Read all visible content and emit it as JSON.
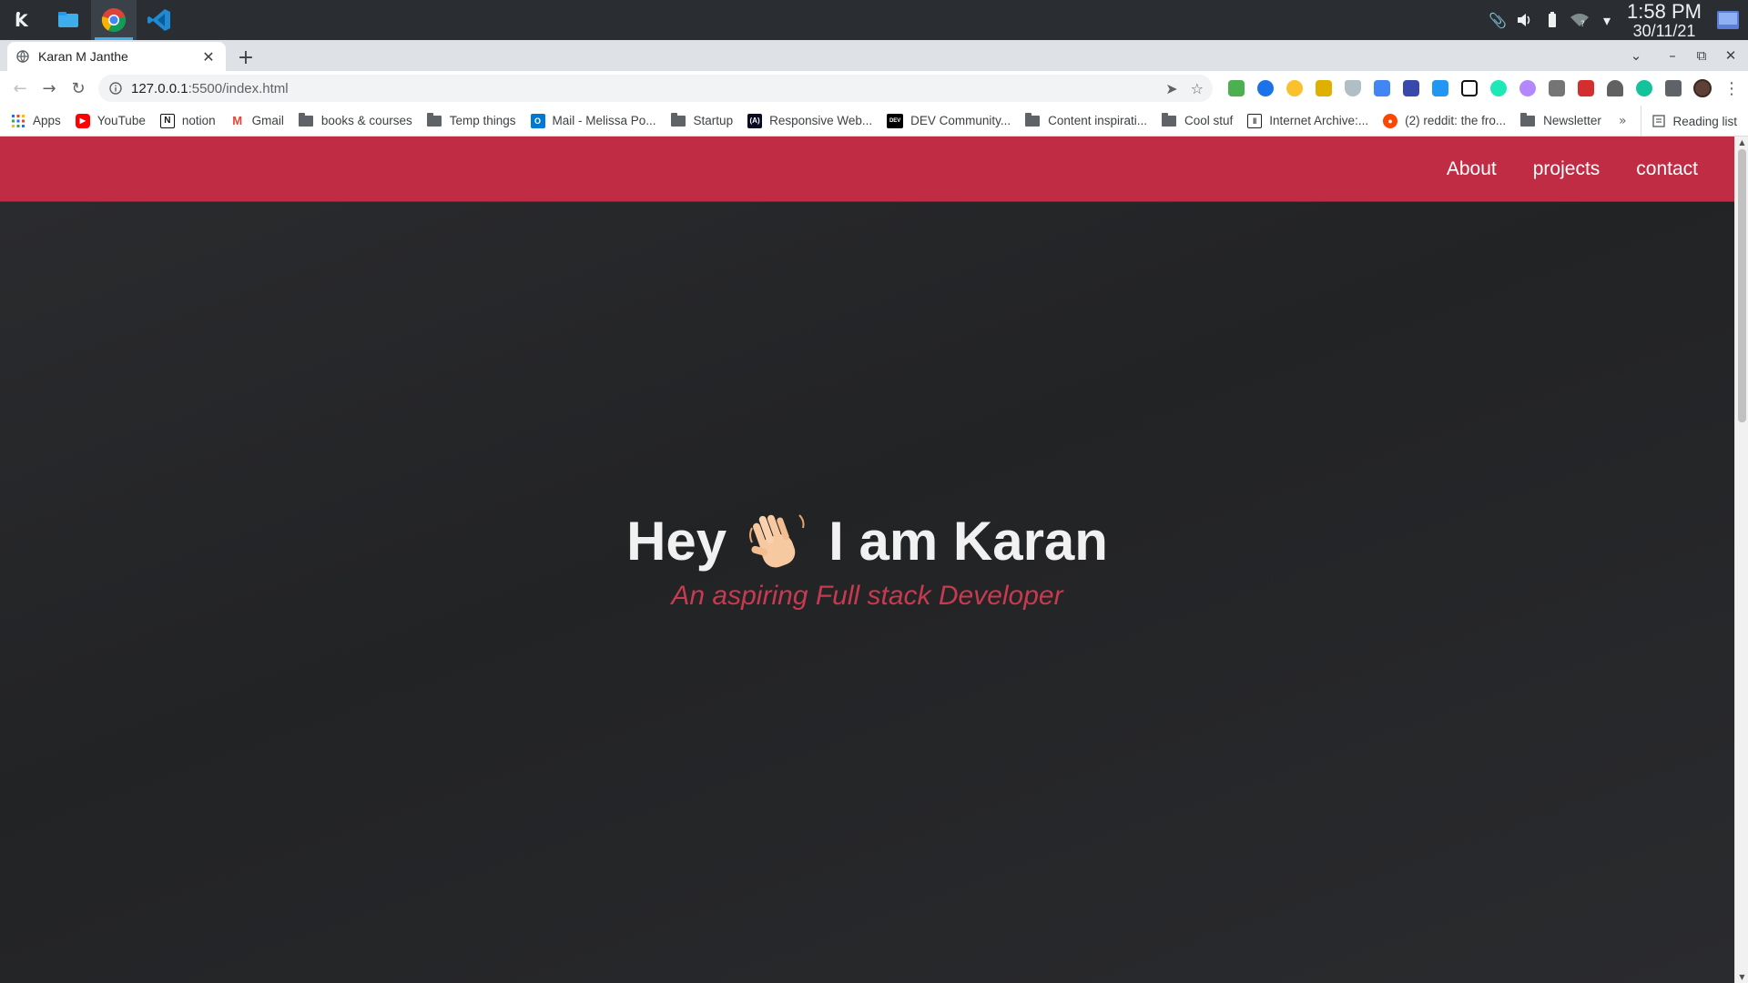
{
  "taskbar": {
    "apps": [
      "kde-menu",
      "dolphin",
      "chrome",
      "vscode"
    ],
    "clock_time": "1:58 PM",
    "clock_date": "30/11/21"
  },
  "browser": {
    "tab_title": "Karan M Janthe",
    "url_host": "127.0.0.1",
    "url_rest": ":5500/index.html",
    "bookmarks": [
      {
        "label": "Apps",
        "icon": "apps-grid"
      },
      {
        "label": "YouTube",
        "icon": "youtube"
      },
      {
        "label": "notion",
        "icon": "notion"
      },
      {
        "label": "Gmail",
        "icon": "gmail"
      },
      {
        "label": "books & courses",
        "icon": "folder"
      },
      {
        "label": "Temp things",
        "icon": "folder"
      },
      {
        "label": "Mail - Melissa Po...",
        "icon": "outlook"
      },
      {
        "label": "Startup",
        "icon": "folder"
      },
      {
        "label": "Responsive Web...",
        "icon": "freecodecamp"
      },
      {
        "label": "DEV Community...",
        "icon": "dev"
      },
      {
        "label": "Content inspirati...",
        "icon": "folder"
      },
      {
        "label": "Cool stuf",
        "icon": "folder"
      },
      {
        "label": "Internet Archive:...",
        "icon": "archive"
      },
      {
        "label": "(2) reddit: the fro...",
        "icon": "reddit"
      },
      {
        "label": "Newsletter",
        "icon": "folder"
      }
    ],
    "more_bookmarks": "»",
    "reading_list": "Reading list"
  },
  "site": {
    "nav": [
      "About",
      "projects",
      "contact"
    ],
    "hero_before": "Hey",
    "hero_after": "I am Karan",
    "subtitle": "An aspiring Full stack Developer",
    "nav_color": "#bf2c44",
    "subtitle_color": "#c73a4f"
  }
}
